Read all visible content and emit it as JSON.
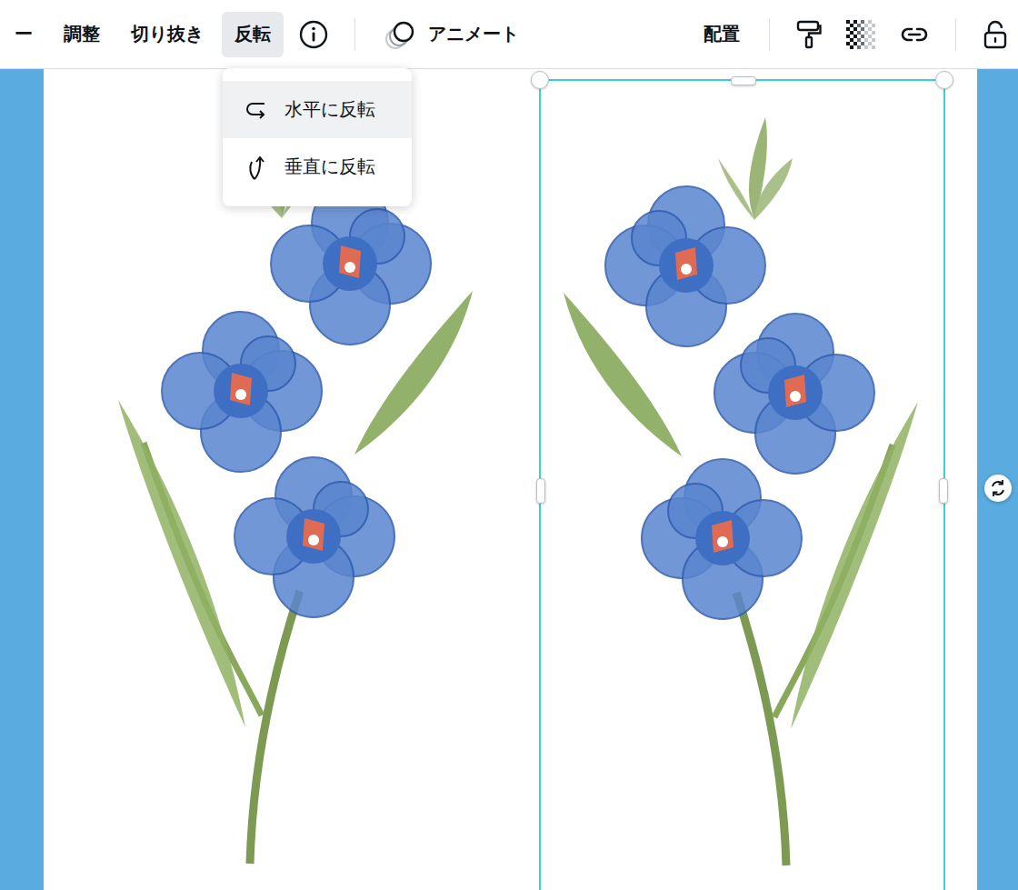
{
  "toolbar": {
    "items": [
      {
        "label": "ー",
        "selected": false
      },
      {
        "label": "調整",
        "selected": false
      },
      {
        "label": "切り抜き",
        "selected": false
      },
      {
        "label": "反転",
        "selected": true
      }
    ],
    "animate": "アニメート",
    "arrange": "配置"
  },
  "flip_menu": {
    "open": true,
    "items": [
      {
        "label": "水平に反転",
        "kind": "horizontal",
        "selected": true
      },
      {
        "label": "垂直に反転",
        "kind": "vertical",
        "selected": false
      }
    ]
  },
  "canvas": {
    "images": [
      {
        "mirrored": false,
        "selected": false
      },
      {
        "mirrored": true,
        "selected": true
      }
    ]
  }
}
